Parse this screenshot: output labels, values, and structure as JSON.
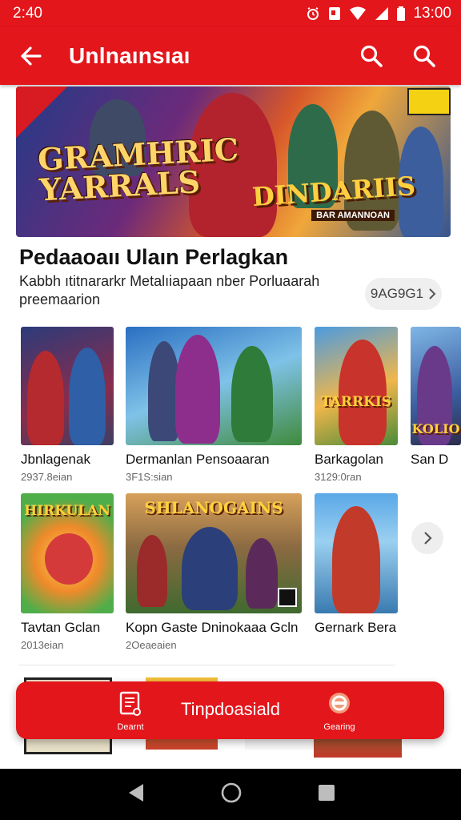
{
  "status_bar": {
    "time_left": "2:40",
    "time_right": "13:00"
  },
  "app_bar": {
    "title": "Unlnaınsıaı"
  },
  "hero": {
    "title_left_1": "GRAMHRIC",
    "title_left_2": "YARRALS",
    "title_right": "DINDARIIS",
    "subtitle_right": "BAR AMANNOAN"
  },
  "section": {
    "title": "Pedaaoaıı Ulaın Perlagkan",
    "subtitle": "Kabbh ıtitnararkr Metalıiapaan nber Porluaarah preemaarion",
    "more_label": "9AG9G1"
  },
  "row1": [
    {
      "title": "Jbnlagenak",
      "meta": "2937.8eian"
    },
    {
      "title": "Dermanlan Pensoaaran",
      "meta": "3F1S:sian"
    },
    {
      "title": "Barkagolan",
      "meta": "3129:0ran"
    },
    {
      "title": "San D",
      "meta": ""
    }
  ],
  "row1_art": {
    "card3_text": "TARRKIS",
    "card4_text": "KOLIO"
  },
  "row2": [
    {
      "title": "Tavtan Gclan",
      "meta": "2013eian",
      "art_text": "HIRKULAN"
    },
    {
      "title": "Kopn Gaste Dninokaaa Gcln",
      "meta": "2Oeaeaien",
      "art_text": "SHLANOGAINS"
    },
    {
      "title": "Gernark Bera",
      "meta": ""
    }
  ],
  "bottom_bar": {
    "left_label": "Dearnt",
    "center_label": "Tinpdoasiald",
    "right_label": "Gearing"
  },
  "colors": {
    "brand": "#e3161b"
  }
}
